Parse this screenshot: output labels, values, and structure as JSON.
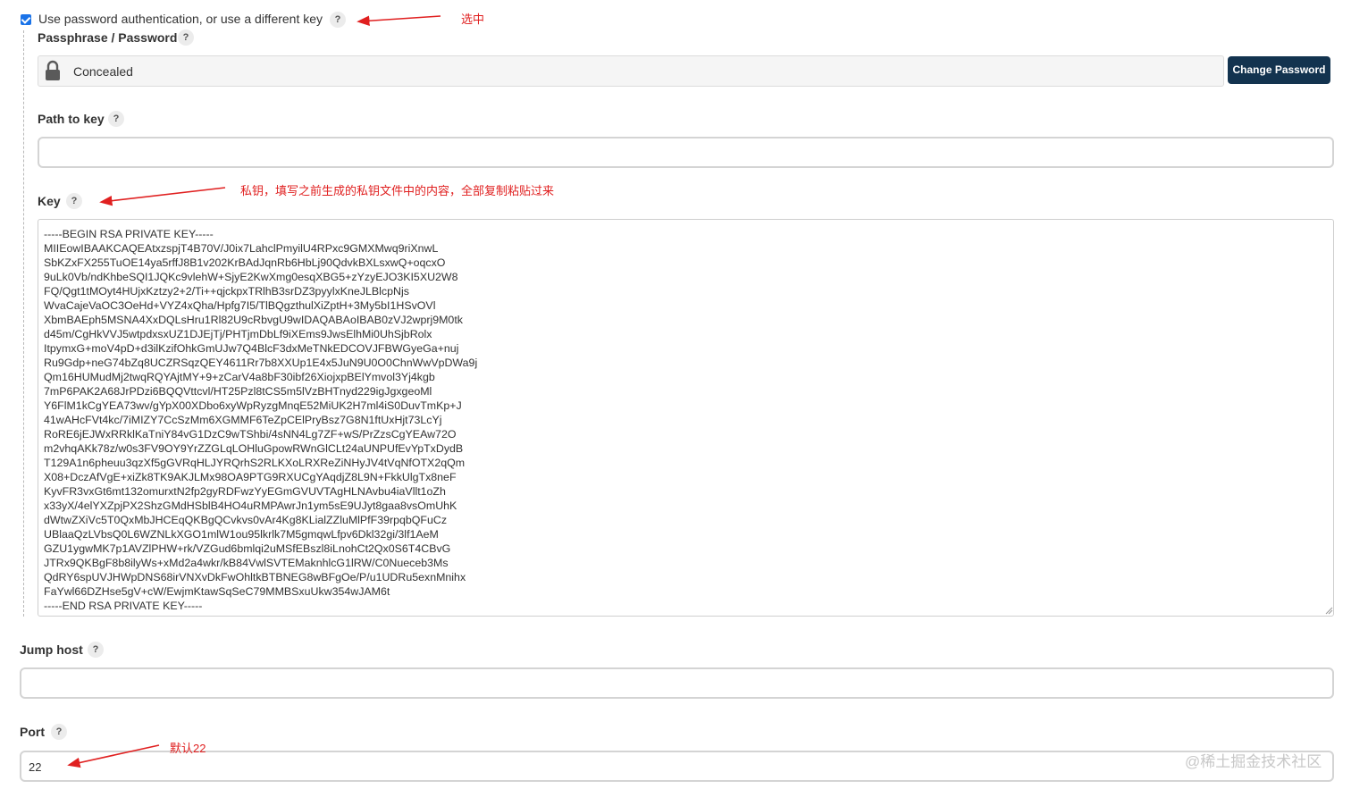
{
  "auth": {
    "checkbox_label": "Use password authentication, or use a different key",
    "checked": true
  },
  "passphrase": {
    "label": "Passphrase / Password",
    "value": "Concealed",
    "change_button": "Change Password"
  },
  "path_to_key": {
    "label": "Path to key",
    "value": ""
  },
  "key": {
    "label": "Key",
    "lines": [
      "-----BEGIN RSA PRIVATE KEY-----",
      "MIIEowIBAAKCAQEAtxzspjT4B70V/J0ix7LahclPmyilU4RPxc9GMXMwq9riXnwL",
      "SbKZxFX255TuOE14ya5rffJ8B1v202KrBAdJqnRb6HbLj90QdvkBXLsxwQ+oqcxO",
      "9uLk0Vb/ndKhbeSQI1JQKc9vlehW+SjyE2KwXmg0esqXBG5+zYzyEJO3KI5XU2W8",
      "FQ/Qgt1tMOyt4HUjxKztzy2+2/Ti++qjckpxTRlhB3srDZ3pyylxKneJLBlcpNjs",
      "WvaCajeVaOC3OeHd+VYZ4xQha/Hpfg7I5/TlBQgzthulXiZptH+3My5bI1HSvOVl",
      "XbmBAEph5MSNA4XxDQLsHru1Rl82U9cRbvgU9wIDAQABAoIBAB0zVJ2wprj9M0tk",
      "d45m/CgHkVVJ5wtpdxsxUZ1DJEjTj/PHTjmDbLf9iXEms9JwsElhMi0UhSjbRolx",
      "ItpymxG+moV4pD+d3ilKzifOhkGmUJw7Q4BlcF3dxMeTNkEDCOVJFBWGyeGa+nuj",
      "Ru9Gdp+neG74bZq8UCZRSqzQEY4611Rr7b8XXUp1E4x5JuN9U0O0ChnWwVpDWa9j",
      "Qm16HUMudMj2twqRQYAjtMY+9+zCarV4a8bF30ibf26XiojxpBElYmvol3Yj4kgb",
      "7mP6PAK2A68JrPDzi6BQQVttcvl/HT25Pzl8tCS5m5lVzBHTnyd229igJgxgeoMl",
      "Y6FlM1kCgYEA73wv/gYpX00XDbo6xyWpRyzgMnqE52MiUK2H7ml4iS0DuvTmKp+J",
      "41wAHcFVt4kc/7iMIZY7CcSzMm6XGMMF6TeZpCElPryBsz7G8N1ftUxHjt73LcYj",
      "RoRE6jEJWxRRklKaTniY84vG1DzC9wTShbi/4sNN4Lg7ZF+wS/PrZzsCgYEAw72O",
      "m2vhqAKk78z/w0s3FV9OY9YrZZGLqLOHluGpowRWnGlCLt24aUNPUfEvYpTxDydB",
      "T129A1n6pheuu3qzXf5gGVRqHLJYRQrhS2RLKXoLRXReZiNHyJV4tVqNfOTX2qQm",
      "X08+DczAfVgE+xiZk8TK9AKJLMx98OA9PTG9RXUCgYAqdjZ8L9N+FkkUlgTx8neF",
      "KyvFR3vxGt6mt132omurxtN2fp2gyRDFwzYyEGmGVUVTAgHLNAvbu4iaVllt1oZh",
      "x33yX/4elYXZpjPX2ShzGMdHSblB4HO4uRMPAwrJn1ym5sE9UJyt8gaa8vsOmUhK",
      "dWtwZXiVc5T0QxMbJHCEqQKBgQCvkvs0vAr4Kg8KLialZZluMlPfF39rpqbQFuCz",
      "UBlaaQzLVbsQ0L6WZNLkXGO1mlW1ou95lkrlk7M5gmqwLfpv6Dkl32gi/3lf1AeM",
      "GZU1ygwMK7p1AVZlPHW+rk/VZGud6bmlqi2uMSfEBszl8iLnohCt2Qx0S6T4CBvG",
      "JTRx9QKBgF8b8ilyWs+xMd2a4wkr/kB84VwlSVTEMaknhlcG1lRW/C0Nueceb3Ms",
      "QdRY6spUVJHWpDNS68irVNXvDkFwOhltkBTBNEG8wBFgOe/P/u1UDRu5exnMnihx",
      "FaYwl66DZHse5gV+cW/EwjmKtawSqSeC79MMBSxuUkw354wJAM6t",
      "-----END RSA PRIVATE KEY-----"
    ]
  },
  "jump_host": {
    "label": "Jump host",
    "value": ""
  },
  "port": {
    "label": "Port",
    "value": "22"
  },
  "help_glyph": "?",
  "annotations": {
    "checkbox_note": "选中",
    "key_note": "私钥，填写之前生成的私钥文件中的内容，全部复制粘贴过来",
    "port_note": "默认22"
  },
  "watermark": "@稀土掘金技术社区",
  "colors": {
    "button": "#13334f",
    "annotation": "#e02020",
    "checkbox": "#1a73e8"
  },
  "icons": [
    "lock-icon",
    "help-icon",
    "arrow-annotation"
  ]
}
